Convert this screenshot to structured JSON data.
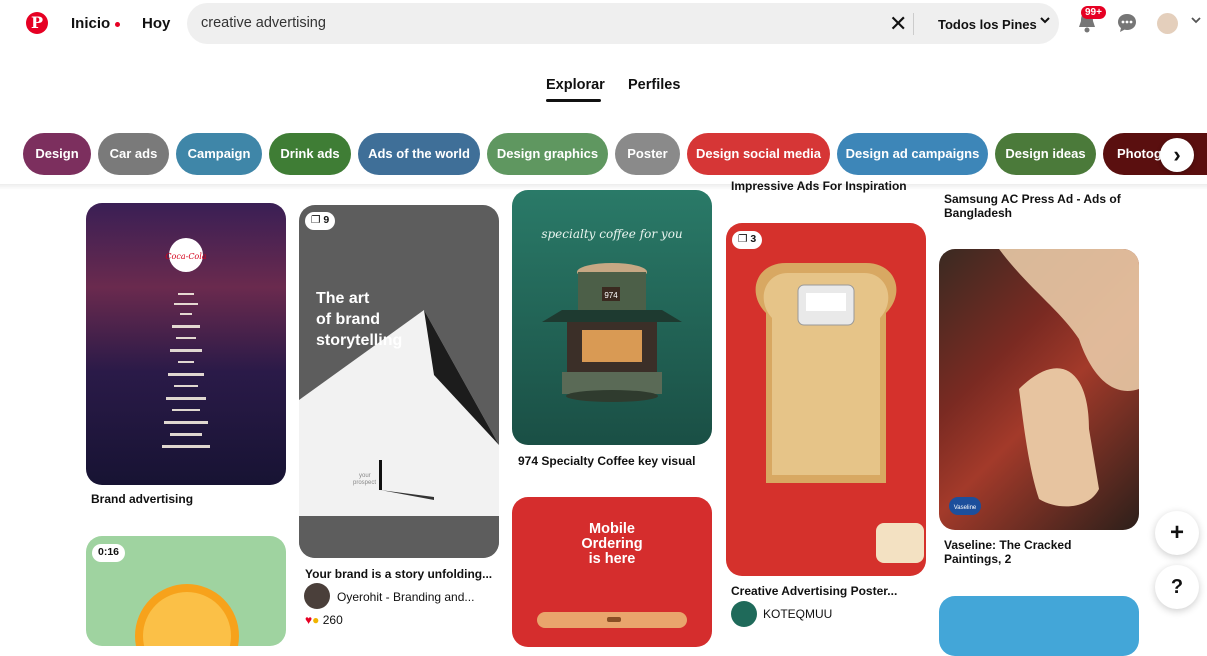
{
  "header": {
    "logo": "P",
    "home": "Inicio",
    "today": "Hoy",
    "search_value": "creative advertising",
    "scope": "Todos los Pines",
    "notif_badge": "99+"
  },
  "tabs": [
    "Explorar",
    "Perfiles"
  ],
  "chips": [
    {
      "label": "Design",
      "color": "#7c2f5e"
    },
    {
      "label": "Car ads",
      "color": "#7a7a7a"
    },
    {
      "label": "Campaign",
      "color": "#3f86a8"
    },
    {
      "label": "Drink ads",
      "color": "#3f7d35"
    },
    {
      "label": "Ads of the world",
      "color": "#3f6f98"
    },
    {
      "label": "Design graphics",
      "color": "#5f9760"
    },
    {
      "label": "Poster",
      "color": "#8a8a8a"
    },
    {
      "label": "Design social media",
      "color": "#d63636"
    },
    {
      "label": "Design ad campaigns",
      "color": "#3d86b8"
    },
    {
      "label": "Design ideas",
      "color": "#4b7a3a"
    },
    {
      "label": "Photogr",
      "color": "#5a0f0f"
    }
  ],
  "pins": {
    "brand_advertising": {
      "title": "Brand advertising",
      "logo_text": "Coca-Cola"
    },
    "storytelling": {
      "count": "9",
      "text": "The art\nof brand\nstorytelling",
      "title": "Your brand is a story unfolding...",
      "author": "Oyerohit - Branding and...",
      "reactions": "260",
      "caption": "your\nprospect"
    },
    "coffee": {
      "title": "974 Specialty Coffee key visual",
      "tagline": "specialty coffee for you",
      "sign": "974"
    },
    "mobile": {
      "text": "Mobile\nOrdering\nis here"
    },
    "bread": {
      "count": "3",
      "title": "Creative Advertising Poster...",
      "author": "KOTEQMUU",
      "top_title": "Impressive Ads For Inspiration"
    },
    "samsung": {
      "title": "Samsung AC Press Ad - Ads of Bangladesh"
    },
    "vaseline": {
      "title": "Vaseline: The Cracked Paintings, 2",
      "logo_text": "Vaseline"
    },
    "orange": {
      "duration": "0:16"
    }
  },
  "fab": {
    "add": "+",
    "help": "?"
  }
}
